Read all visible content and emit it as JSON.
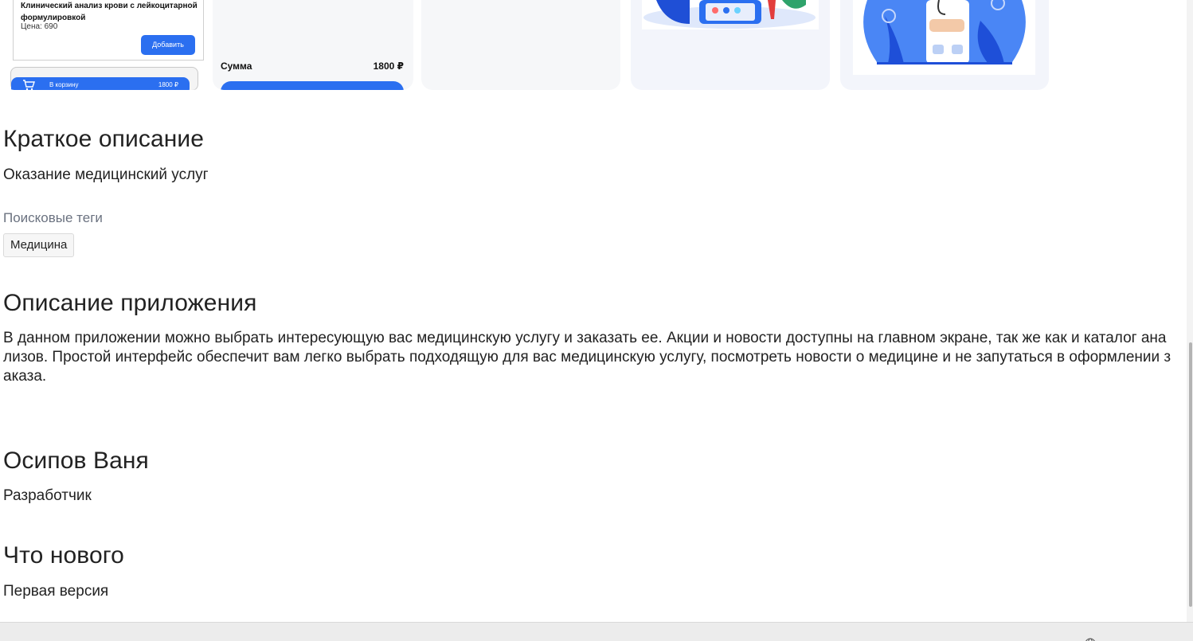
{
  "screens": {
    "cart": {
      "item_title": "Клинический анализ крови с лейкоцитарной формулировкой",
      "item_price": "Цена: 690",
      "add_button": "Добавить",
      "cart_label": "В корзину",
      "cart_total": "1800 ₽"
    },
    "summary": {
      "sum_label": "Сумма",
      "sum_value": "1800 ₽"
    }
  },
  "short_description": {
    "heading": "Краткое описание",
    "text": "Оказание медицинский услуг"
  },
  "search_tags": {
    "label": "Поисковые теги",
    "tags": [
      "Медицина"
    ]
  },
  "app_description": {
    "heading": "Описание приложения",
    "text": "В данном приложении можно выбрать интересующую вас медицинскую услугу и заказать ее. Акции и новости доступны на главном экране, так же как и каталог анализов. Простой интерфейс обеспечит вам легко выбрать подходящую для вас медицинскую услугу, посмотреть новости о медицине и не запутаться в оформлении заказа."
  },
  "developer": {
    "name": "Осипов Ваня",
    "role": "Разработчик"
  },
  "whats_new": {
    "heading": "Что нового",
    "text": "Первая версия"
  },
  "colors": {
    "accent": "#2b6ff0",
    "text": "#222222",
    "muted": "#6b7280"
  },
  "icons": {
    "cart": "cart-icon",
    "globe": "globe-icon"
  }
}
